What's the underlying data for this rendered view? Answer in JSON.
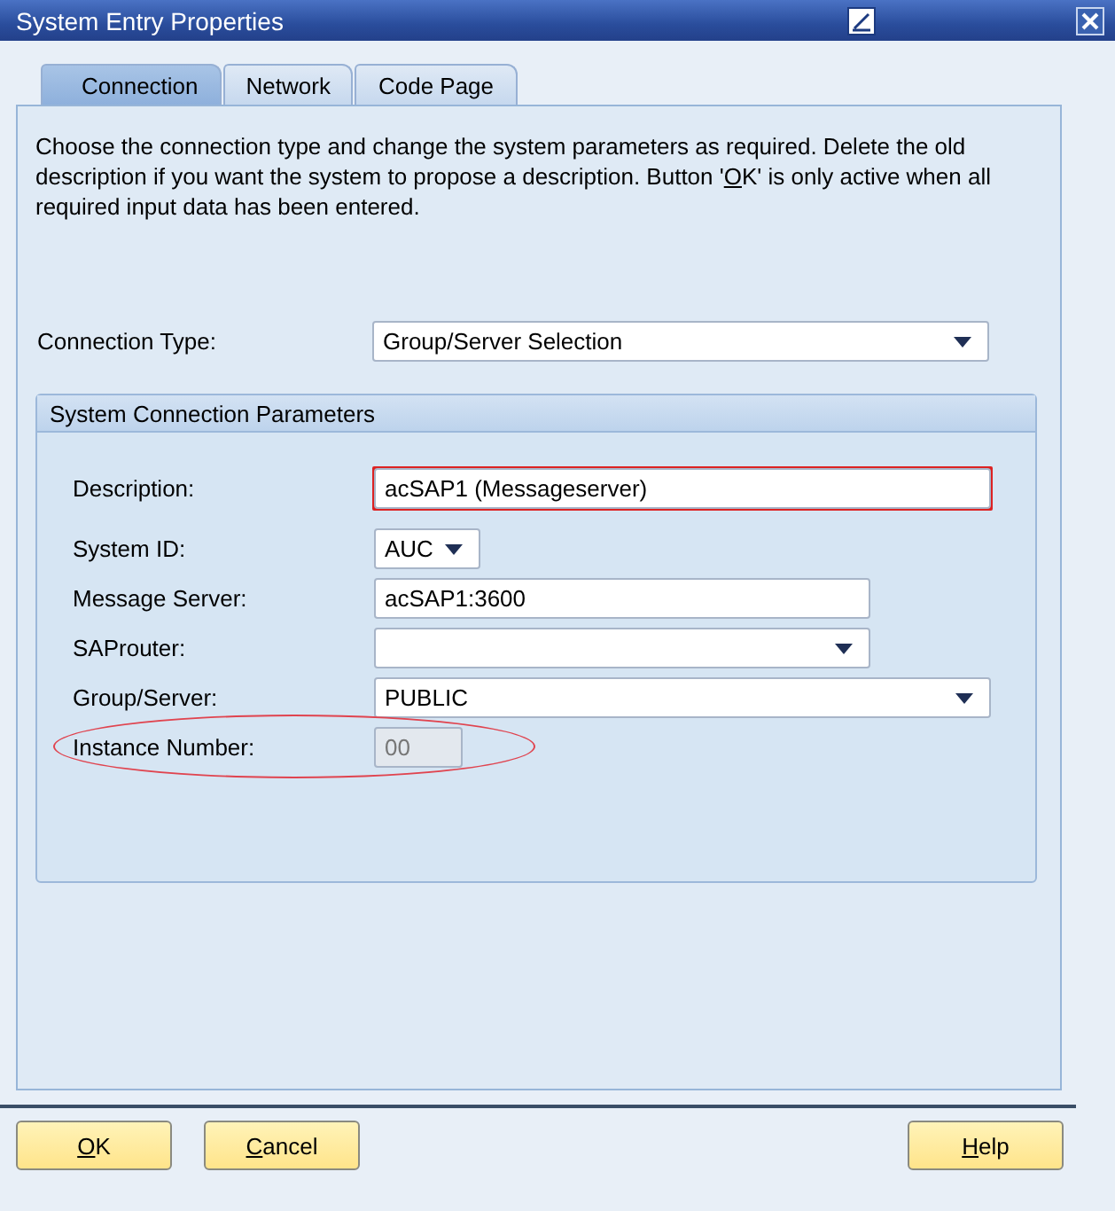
{
  "window": {
    "title": "System Entry Properties"
  },
  "tabs": [
    {
      "label": "Connection",
      "selected": true
    },
    {
      "label": "Network",
      "selected": false
    },
    {
      "label": "Code Page",
      "selected": false
    }
  ],
  "intro": {
    "before": "Choose the connection type and change the system parameters as required. Delete the old description if you want the system to propose a description. Button '",
    "key": "O",
    "key_rest": "K",
    "after": "' is only active when all required input data has been entered."
  },
  "connection_type": {
    "label": "Connection Type:",
    "value": "Group/Server Selection"
  },
  "group_box": {
    "title": "System Connection Parameters",
    "fields": [
      {
        "label": "Description:",
        "kind": "text",
        "value": "acSAP1 (Messageserver)",
        "required": true,
        "disabled": false,
        "highlighted": false
      },
      {
        "label": "System ID:",
        "kind": "dropdown",
        "value": "AUC",
        "required": false,
        "disabled": false,
        "highlighted": false
      },
      {
        "label": "Message Server:",
        "kind": "text",
        "value": "acSAP1:3600",
        "required": false,
        "disabled": false,
        "highlighted": false
      },
      {
        "label": "SAProuter:",
        "kind": "dropdown",
        "required": false,
        "disabled": false,
        "highlighted": false
      },
      {
        "label": "Group/Server:",
        "kind": "dropdown",
        "value": "PUBLIC",
        "required": false,
        "disabled": false,
        "highlighted": false
      },
      {
        "label": "Instance Number:",
        "kind": "text",
        "value": "00",
        "required": false,
        "disabled": true,
        "highlighted": true
      }
    ]
  },
  "buttons": [
    {
      "key": "O",
      "rest": "K"
    },
    {
      "key": "C",
      "rest": "ancel"
    },
    {
      "key": "H",
      "rest": "elp"
    }
  ]
}
